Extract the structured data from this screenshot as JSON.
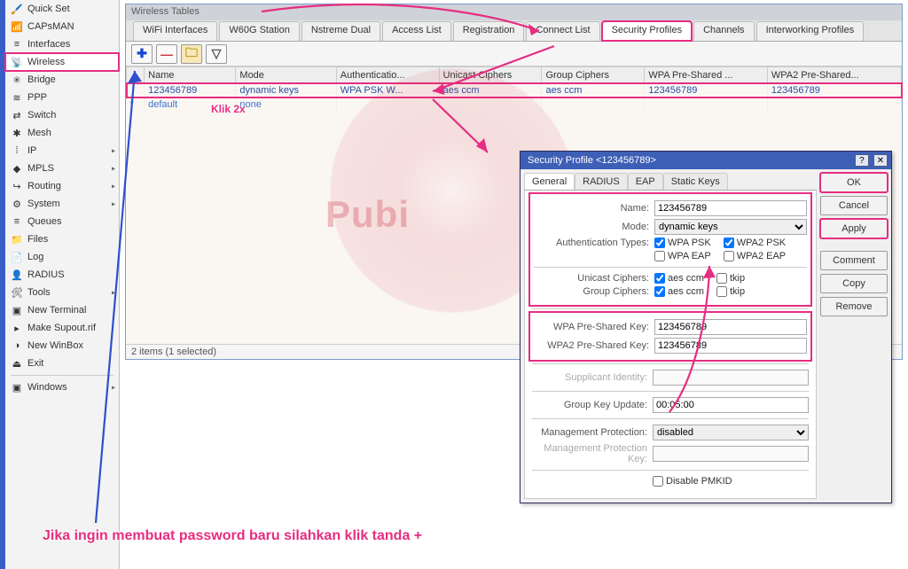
{
  "sidebar": {
    "items": [
      {
        "icon": "🖌️",
        "label": "Quick Set",
        "sub": false
      },
      {
        "icon": "📶",
        "label": "CAPsMAN",
        "sub": false
      },
      {
        "icon": "≡",
        "label": "Interfaces",
        "sub": false
      },
      {
        "icon": "📡",
        "label": "Wireless",
        "sub": false
      },
      {
        "icon": "✳",
        "label": "Bridge",
        "sub": false
      },
      {
        "icon": "≋",
        "label": "PPP",
        "sub": false
      },
      {
        "icon": "⇄",
        "label": "Switch",
        "sub": false
      },
      {
        "icon": "✱",
        "label": "Mesh",
        "sub": false
      },
      {
        "icon": "⁞",
        "label": "IP",
        "sub": true
      },
      {
        "icon": "◆",
        "label": "MPLS",
        "sub": true
      },
      {
        "icon": "↪",
        "label": "Routing",
        "sub": true
      },
      {
        "icon": "⚙",
        "label": "System",
        "sub": true
      },
      {
        "icon": "≡",
        "label": "Queues",
        "sub": false
      },
      {
        "icon": "📁",
        "label": "Files",
        "sub": false
      },
      {
        "icon": "📄",
        "label": "Log",
        "sub": false
      },
      {
        "icon": "👤",
        "label": "RADIUS",
        "sub": false
      },
      {
        "icon": "🛠",
        "label": "Tools",
        "sub": true
      },
      {
        "icon": "▣",
        "label": "New Terminal",
        "sub": false
      },
      {
        "icon": "▸",
        "label": "Make Supout.rif",
        "sub": false
      },
      {
        "icon": "◑",
        "label": "New WinBox",
        "sub": false
      },
      {
        "icon": "⏏",
        "label": "Exit",
        "sub": false
      },
      {
        "icon": "",
        "label": "",
        "sub": false,
        "sep": true
      },
      {
        "icon": "▣",
        "label": "Windows",
        "sub": true
      }
    ],
    "selected_index": 3
  },
  "panel": {
    "title": "Wireless Tables",
    "tabs": [
      "WiFi Interfaces",
      "W60G Station",
      "Nstreme Dual",
      "Access List",
      "Registration",
      "Connect List",
      "Security Profiles",
      "Channels",
      "Interworking Profiles"
    ],
    "active_tab": 6,
    "toolbar": {
      "add": "✚",
      "del": "—",
      "copy": "🗀",
      "filter": "▽"
    },
    "columns": [
      "",
      "Name",
      "Mode",
      "Authenticatio...",
      "Unicast Ciphers",
      "Group Ciphers",
      "WPA Pre-Shared ...",
      "WPA2 Pre-Shared..."
    ],
    "rows": [
      {
        "marker": "",
        "name": "123456789",
        "mode": "dynamic keys",
        "auth": "WPA PSK W...",
        "uni": "aes ccm",
        "grp": "aes ccm",
        "wpa": "123456789",
        "wpa2": "123456789"
      },
      {
        "marker": "*",
        "name": "default",
        "mode": "none",
        "auth": "",
        "uni": "",
        "grp": "",
        "wpa": "",
        "wpa2": ""
      }
    ],
    "status": "2 items (1 selected)"
  },
  "dialog": {
    "title": "Security Profile <123456789>",
    "tabs": [
      "General",
      "RADIUS",
      "EAP",
      "Static Keys"
    ],
    "active_tab": 0,
    "fields": {
      "name_label": "Name:",
      "name": "123456789",
      "mode_label": "Mode:",
      "mode": "dynamic keys",
      "auth_types_label": "Authentication Types:",
      "wpa_psk": "WPA PSK",
      "wpa2_psk": "WPA2 PSK",
      "wpa_eap": "WPA EAP",
      "wpa2_eap": "WPA2 EAP",
      "uni_label": "Unicast Ciphers:",
      "grp_label": "Group Ciphers:",
      "aesccm": "aes ccm",
      "tkip": "tkip",
      "wpa_key_label": "WPA Pre-Shared Key:",
      "wpa_key": "123456789",
      "wpa2_key_label": "WPA2 Pre-Shared Key:",
      "wpa2_key": "123456789",
      "supplicant_label": "Supplicant Identity:",
      "supplicant": "",
      "grpkey_label": "Group Key Update:",
      "grpkey": "00:05:00",
      "mgmt_prot_label": "Management Protection:",
      "mgmt_prot": "disabled",
      "mgmt_key_label": "Management Protection Key:",
      "mgmt_key": "",
      "disable_pmkid": "Disable PMKID"
    },
    "buttons": {
      "ok": "OK",
      "cancel": "Cancel",
      "apply": "Apply",
      "comment": "Comment",
      "copy": "Copy",
      "remove": "Remove"
    }
  },
  "annotations": {
    "klik2x": "Klik 2x",
    "bottom": "Jika ingin membuat password baru silahkan klik tanda +",
    "watermark": "Pubi"
  }
}
